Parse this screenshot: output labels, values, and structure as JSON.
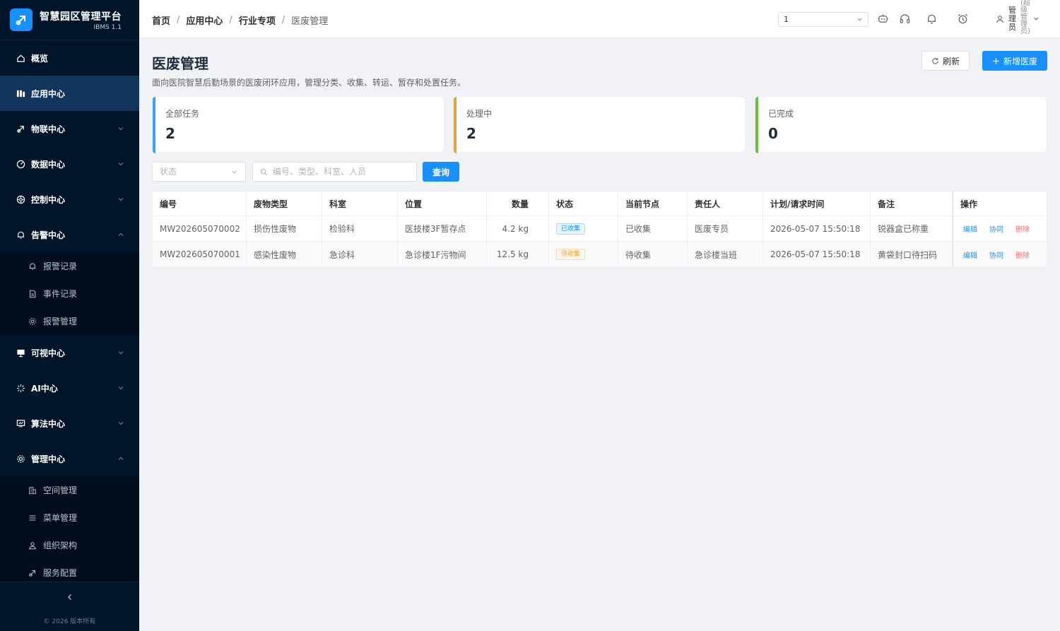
{
  "brand": {
    "title": "智慧园区管理平台",
    "version": "IBMS 1.1"
  },
  "sidebar": {
    "items": [
      {
        "label": "概览",
        "icon": "home-icon"
      },
      {
        "label": "应用中心",
        "icon": "apps-icon",
        "active": true
      },
      {
        "label": "物联中心",
        "icon": "iot-icon"
      },
      {
        "label": "数据中心",
        "icon": "data-icon"
      },
      {
        "label": "控制中心",
        "icon": "control-icon"
      },
      {
        "label": "告警中心",
        "icon": "bell-icon",
        "expanded": true
      },
      {
        "label": "可视中心",
        "icon": "monitor-icon"
      },
      {
        "label": "AI中心",
        "icon": "ai-icon"
      },
      {
        "label": "算法中心",
        "icon": "algorithm-icon"
      },
      {
        "label": "管理中心",
        "icon": "gear-icon",
        "expanded": true
      }
    ],
    "alarm_sub": [
      {
        "label": "报警记录"
      },
      {
        "label": "事件记录"
      },
      {
        "label": "报警管理"
      }
    ],
    "manage_sub": [
      {
        "label": "空间管理"
      },
      {
        "label": "菜单管理"
      },
      {
        "label": "组织架构"
      },
      {
        "label": "服务配置"
      }
    ],
    "copyright": "© 2026 版本所有"
  },
  "header": {
    "breadcrumb": [
      "首页",
      "应用中心",
      "行业专项",
      "医废管理"
    ],
    "select_value": "1",
    "user_name": "管理员",
    "user_role": "(超级管理员)"
  },
  "page": {
    "title": "医废管理",
    "description": "面向医院智慧后勤场景的医废闭环应用，管理分类、收集、转运、暂存和处置任务。",
    "refresh_label": "刷新",
    "add_label": "新增医废"
  },
  "stats": [
    {
      "label": "全部任务",
      "value": "2",
      "color": "#409eff"
    },
    {
      "label": "处理中",
      "value": "2",
      "color": "#e6a23c"
    },
    {
      "label": "已完成",
      "value": "0",
      "color": "#67c23a"
    }
  ],
  "filters": {
    "status_placeholder": "状态",
    "search_placeholder": "编号、类型、科室、人员",
    "query_label": "查询"
  },
  "table": {
    "columns": [
      "编号",
      "废物类型",
      "科室",
      "位置",
      "数量",
      "状态",
      "当前节点",
      "责任人",
      "计划/请求时间",
      "备注",
      "操作"
    ],
    "rows": [
      {
        "id": "MW202605070002",
        "type": "损伤性废物",
        "dept": "检验科",
        "location": "医技楼3F暂存点",
        "qty": "4.2 kg",
        "status": "已收集",
        "node": "已收集",
        "owner": "医废专员",
        "time": "2026-05-07 15:50:18",
        "note": "锐器盒已称重"
      },
      {
        "id": "MW202605070001",
        "type": "感染性废物",
        "dept": "急诊科",
        "location": "急诊楼1F污物间",
        "qty": "12.5 kg",
        "status": "待收集",
        "node": "待收集",
        "owner": "急诊楼当班",
        "time": "2026-05-07 15:50:18",
        "note": "黄袋封口待扫码"
      }
    ],
    "actions": {
      "edit": "编辑",
      "assist": "协同",
      "delete": "删除"
    }
  },
  "colors": {
    "primary": "#1890ff",
    "sidebar_bg": "#001529",
    "danger": "#f56c6c"
  }
}
